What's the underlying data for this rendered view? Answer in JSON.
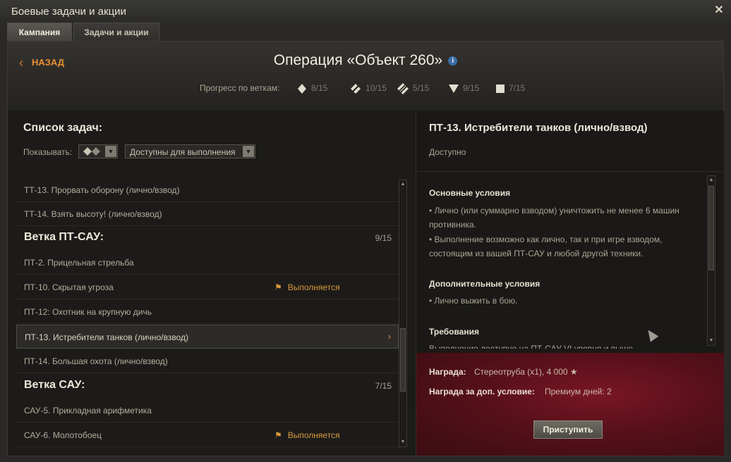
{
  "window": {
    "title": "Боевые задачи и акции"
  },
  "tabs": [
    {
      "label": "Кампания",
      "active": true
    },
    {
      "label": "Задачи и акции",
      "active": false
    }
  ],
  "header": {
    "back_label": "НАЗАД",
    "title": "Операция «Объект 260»",
    "info_glyph": "i",
    "progress_label": "Прогресс по веткам:",
    "branches": [
      {
        "icon": "light-tank-icon",
        "value": "8/15"
      },
      {
        "icon": "medium-tank-icon",
        "value": "10/15"
      },
      {
        "icon": "heavy-tank-icon",
        "value": "5/15"
      },
      {
        "icon": "tank-destroyer-icon",
        "value": "9/15"
      },
      {
        "icon": "spg-icon",
        "value": "7/15"
      }
    ]
  },
  "left": {
    "title": "Список задач:",
    "show_label": "Показывать:",
    "filter_type": "",
    "filter_status": "Доступны для выполнения"
  },
  "tasks": {
    "r1": "ТТ-13. Прорвать оборону (лично/взвод)",
    "r2": "ТТ-14. Взять высоту! (лично/взвод)",
    "s1": {
      "title": "Ветка ПТ-САУ:",
      "count": "9/15"
    },
    "r3": "ПТ-2. Прицельная стрельба",
    "r4": "ПТ-10. Скрытая угроза",
    "r4_status": "Выполняется",
    "r5": "ПТ-12: Охотник на крупную дичь",
    "r6": "ПТ-13. Истребители танков (лично/взвод)",
    "r6_arrow": "›",
    "r7": "ПТ-14. Большая охота (лично/взвод)",
    "s2": {
      "title": "Ветка САУ:",
      "count": "7/15"
    },
    "r8": "САУ-5. Прикладная арифметика",
    "r9": "САУ-6. Молотобоец",
    "r9_status": "Выполняется"
  },
  "detail": {
    "title": "ПТ-13. Истребители танков (лично/взвод)",
    "status": "Доступно",
    "main_head": "Основные условия",
    "main_1": "• Лично (или суммарно взводом) уничтожить не менее 6 машин противника.",
    "main_2": "• Выполнение возможно как лично, так и при игре взводом, состоящим из вашей ПТ-САУ и любой другой техники.",
    "extra_head": "Дополнительные условия",
    "extra_1": "• Лично выжить в бою.",
    "req_head": "Требования",
    "req_1": "Выполнение доступно на ПТ-САУ VI уровня и выше."
  },
  "reward": {
    "label": "Награда:",
    "value": "Стереотруба (x1), 4 000 ★",
    "extra_label": "Награда за доп. условие:",
    "extra_value": "Премиум дней: 2",
    "start_button": "Приступить"
  }
}
